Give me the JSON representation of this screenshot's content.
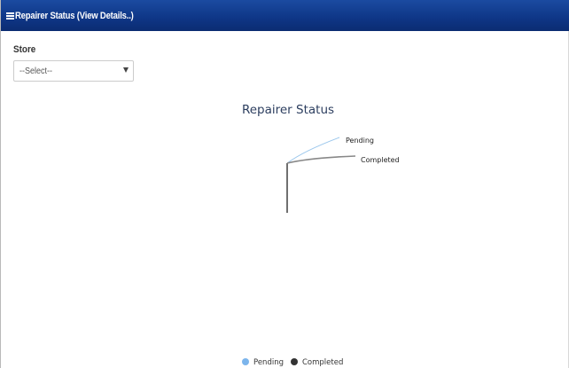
{
  "header": {
    "title": "Repairer Status (View Details..)",
    "menu_icon": "hamburger-menu-icon"
  },
  "filter": {
    "label": "Store",
    "selected": "--Select--"
  },
  "colors": {
    "header_bg": "#0f3788",
    "pending": "#9ac6ec",
    "completed": "#444444"
  },
  "chart_data": {
    "type": "pie",
    "title": "Repairer Status",
    "categories": [
      "Pending",
      "Completed"
    ],
    "values": [
      0,
      0
    ],
    "legend": "bottom",
    "series_colors": [
      "#9ac6ec",
      "#444444"
    ]
  }
}
